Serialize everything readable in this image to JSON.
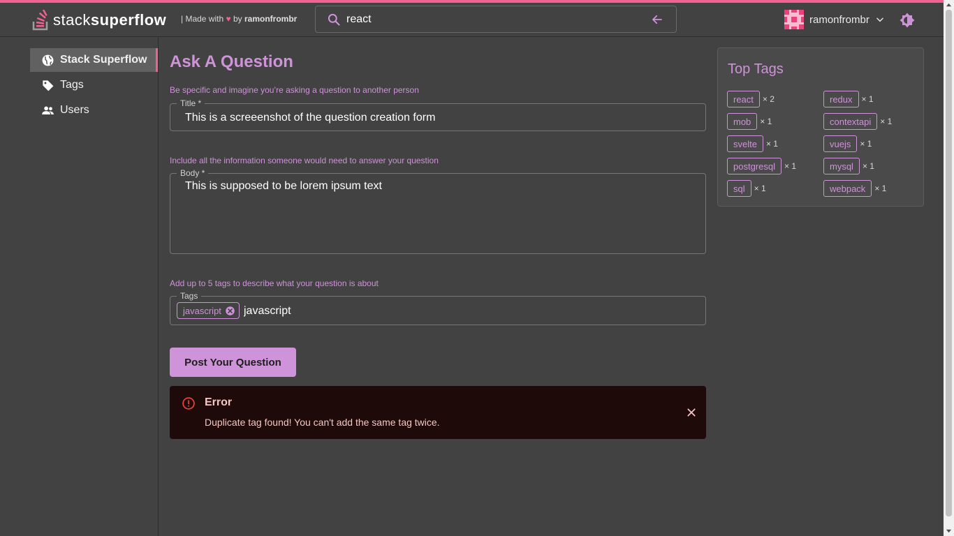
{
  "header": {
    "brand_light": "stack",
    "brand_bold": "superflow",
    "made_prefix": "| Made with",
    "made_by": "by",
    "made_author": "ramonfrombr",
    "search_value": "react",
    "username": "ramonfrombr"
  },
  "sidebar": {
    "items": [
      {
        "label": "Stack Superflow",
        "icon": "globe-icon",
        "active": true
      },
      {
        "label": "Tags",
        "icon": "tag-icon"
      },
      {
        "label": "Users",
        "icon": "users-icon"
      }
    ]
  },
  "form": {
    "page_title": "Ask A Question",
    "title_helper": "Be specific and imagine you’re asking a question to another person",
    "title_legend": "Title *",
    "title_value": "This is a screeenshot of the question creation form",
    "body_helper": "Include all the information someone would need to answer your question",
    "body_legend": "Body *",
    "body_value": "This is supposed to be lorem ipsum text",
    "tags_helper": "Add up to 5 tags to describe what your question is about",
    "tags_legend": "Tags",
    "tag_chips": [
      "javascript"
    ],
    "tags_input_value": "javascript",
    "submit_label": "Post Your Question"
  },
  "alert": {
    "title": "Error",
    "message": "Duplicate tag found! You can't add the same tag twice."
  },
  "top_tags": {
    "title": "Top Tags",
    "tags": [
      {
        "name": "react",
        "count": "× 2"
      },
      {
        "name": "redux",
        "count": "× 1"
      },
      {
        "name": "mob",
        "count": "× 1"
      },
      {
        "name": "contextapi",
        "count": "× 1"
      },
      {
        "name": "svelte",
        "count": "× 1"
      },
      {
        "name": "vuejs",
        "count": "× 1"
      },
      {
        "name": "postgresql",
        "count": "× 1"
      },
      {
        "name": "mysql",
        "count": "× 1"
      },
      {
        "name": "sql",
        "count": "× 1"
      },
      {
        "name": "webpack",
        "count": "× 1"
      }
    ]
  },
  "colors": {
    "accent_pink": "#f06292",
    "accent_purple": "#ce93d8",
    "background": "#424242",
    "error_background": "#1f0a0a",
    "error_text": "#f4c7c3"
  }
}
